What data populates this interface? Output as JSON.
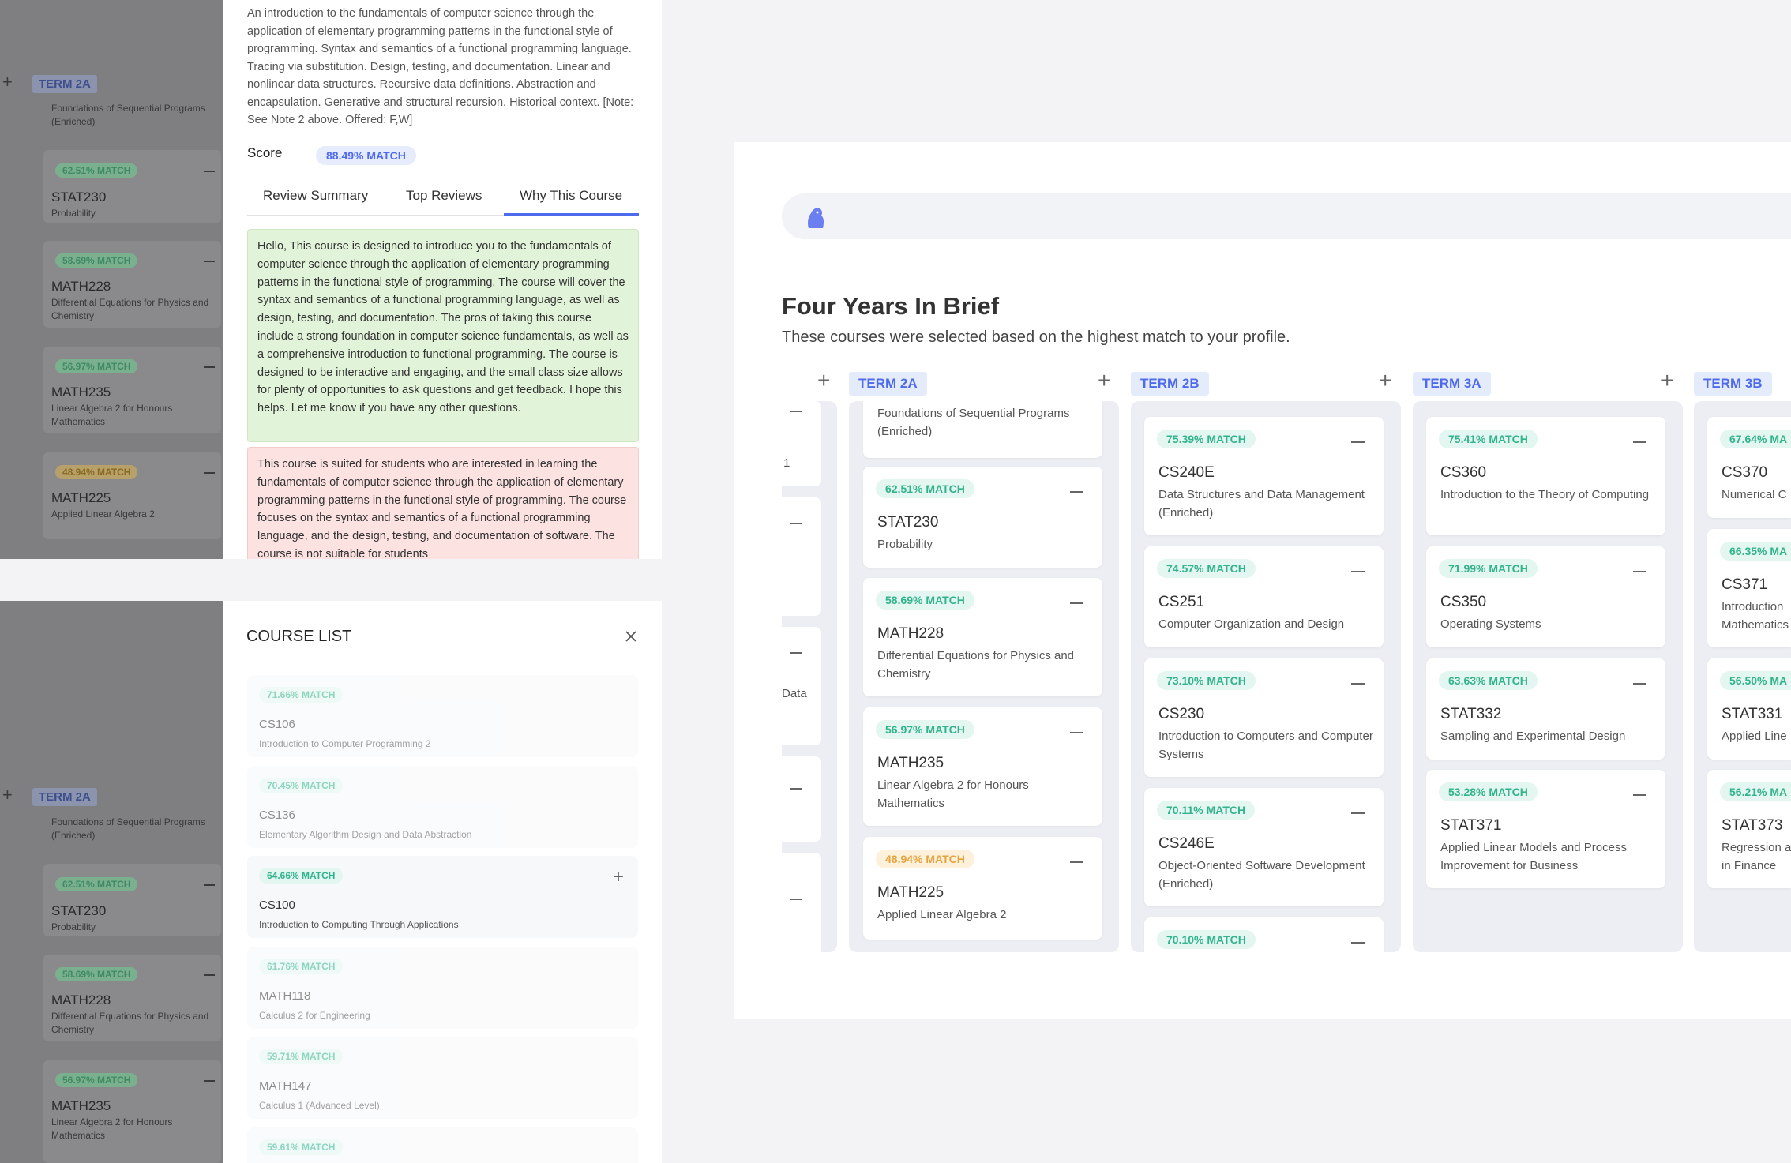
{
  "background_planner": {
    "term_label": "TERM 2A",
    "first_item_name": "Foundations of Sequential Programs (Enriched)",
    "items": [
      {
        "match": "62.51% MATCH",
        "code": "STAT230",
        "name": "Probability"
      },
      {
        "match": "58.69% MATCH",
        "code": "MATH228",
        "name": "Differential Equations for Physics and Chemistry"
      },
      {
        "match": "56.97% MATCH",
        "code": "MATH235",
        "name": "Linear Algebra 2 for Honours Mathematics"
      },
      {
        "match": "48.94% MATCH",
        "code": "MATH225",
        "name": "Applied Linear Algebra 2"
      }
    ]
  },
  "course_detail": {
    "description": "An introduction to the fundamentals of computer science through the application of elementary programming patterns in the functional style of programming. Syntax and semantics of a functional programming language. Tracing via substitution. Design, testing, and documentation. Linear and nonlinear data structures. Recursive data definitions. Abstraction and encapsulation. Generative and structural recursion. Historical context. [Note: See Note 2 above. Offered: F,W]",
    "score_label": "Score",
    "score_value": "88.49% MATCH",
    "tabs": [
      "Review Summary",
      "Top Reviews",
      "Why This Course"
    ],
    "active_tab": "Why This Course",
    "pro_text": "Hello, This course is designed to introduce you to the fundamentals of computer science through the application of elementary programming patterns in the functional style of programming. The course will cover the syntax and semantics of a functional programming language, as well as design, testing, and documentation. The pros of taking this course include a strong foundation in computer science fundamentals, as well as a comprehensive introduction to functional programming. The course is designed to be interactive and engaging, and the small class size allows for plenty of opportunities to ask questions and get feedback. I hope this helps. Let me know if you have any other questions.",
    "con_text": "This course is suited for students who are interested in learning the fundamentals of computer science through the application of elementary programming patterns in the functional style of programming. The course focuses on the syntax and semantics of a functional programming language, and the design, testing, and documentation of software. The course is not suitable for students"
  },
  "course_list": {
    "title": "COURSE LIST",
    "close_icon": "close-icon",
    "items": [
      {
        "match": "71.66% MATCH",
        "code": "CS106",
        "name": "Introduction to Computer Programming 2",
        "addable": false
      },
      {
        "match": "70.45% MATCH",
        "code": "CS136",
        "name": "Elementary Algorithm Design and Data Abstraction",
        "addable": false
      },
      {
        "match": "64.66% MATCH",
        "code": "CS100",
        "name": "Introduction to Computing Through Applications",
        "addable": true
      },
      {
        "match": "61.76% MATCH",
        "code": "MATH118",
        "name": "Calculus 2 for Engineering",
        "addable": false
      },
      {
        "match": "59.71% MATCH",
        "code": "MATH147",
        "name": "Calculus 1 (Advanced Level)",
        "addable": false
      },
      {
        "match": "59.61% MATCH",
        "code": "",
        "name": "",
        "addable": false
      }
    ]
  },
  "planner": {
    "title": "Four Years In Brief",
    "subtitle": "These courses were selected based on the highest match to your profile.",
    "left_partial_labels": [
      "1",
      "Data"
    ],
    "terms": [
      {
        "label": "TERM 2A",
        "first_name": "Foundations of Sequential Programs (Enriched)",
        "courses": [
          {
            "match": "62.51% MATCH",
            "code": "STAT230",
            "name": "Probability"
          },
          {
            "match": "58.69% MATCH",
            "code": "MATH228",
            "name": "Differential Equations for Physics and Chemistry"
          },
          {
            "match": "56.97% MATCH",
            "code": "MATH235",
            "name": "Linear Algebra 2 for Honours Mathematics"
          },
          {
            "match": "48.94% MATCH",
            "code": "MATH225",
            "name": "Applied Linear Algebra 2"
          }
        ]
      },
      {
        "label": "TERM 2B",
        "courses": [
          {
            "match": "75.39% MATCH",
            "code": "CS240E",
            "name": "Data Structures and Data Management (Enriched)"
          },
          {
            "match": "74.57% MATCH",
            "code": "CS251",
            "name": "Computer Organization and Design"
          },
          {
            "match": "73.10% MATCH",
            "code": "CS230",
            "name": "Introduction to Computers and Computer Systems"
          },
          {
            "match": "70.11% MATCH",
            "code": "CS246E",
            "name": "Object-Oriented Software Development (Enriched)"
          },
          {
            "match": "70.10% MATCH",
            "code": "",
            "name": ""
          }
        ]
      },
      {
        "label": "TERM 3A",
        "courses": [
          {
            "match": "75.41% MATCH",
            "code": "CS360",
            "name": "Introduction to the Theory of Computing"
          },
          {
            "match": "71.99% MATCH",
            "code": "CS350",
            "name": "Operating Systems"
          },
          {
            "match": "63.63% MATCH",
            "code": "STAT332",
            "name": "Sampling and Experimental Design"
          },
          {
            "match": "53.28% MATCH",
            "code": "STAT371",
            "name": "Applied Linear Models and Process Improvement for Business"
          }
        ]
      },
      {
        "label": "TERM 3B",
        "courses": [
          {
            "match": "67.64% MA",
            "code": "CS370",
            "name": "Numerical C"
          },
          {
            "match": "66.35% MA",
            "code": "CS371",
            "name": "Introduction Mathematics"
          },
          {
            "match": "56.50% MA",
            "code": "STAT331",
            "name": "Applied Line"
          },
          {
            "match": "56.21% MA",
            "code": "STAT373",
            "name": "Regression a in Finance"
          }
        ]
      }
    ]
  },
  "colors": {
    "accent": "#4f6bed",
    "match_green": "#31b38b",
    "match_warn": "#e6a23c",
    "pro_bg": "#e1f3d8",
    "con_bg": "#fde2e2"
  }
}
